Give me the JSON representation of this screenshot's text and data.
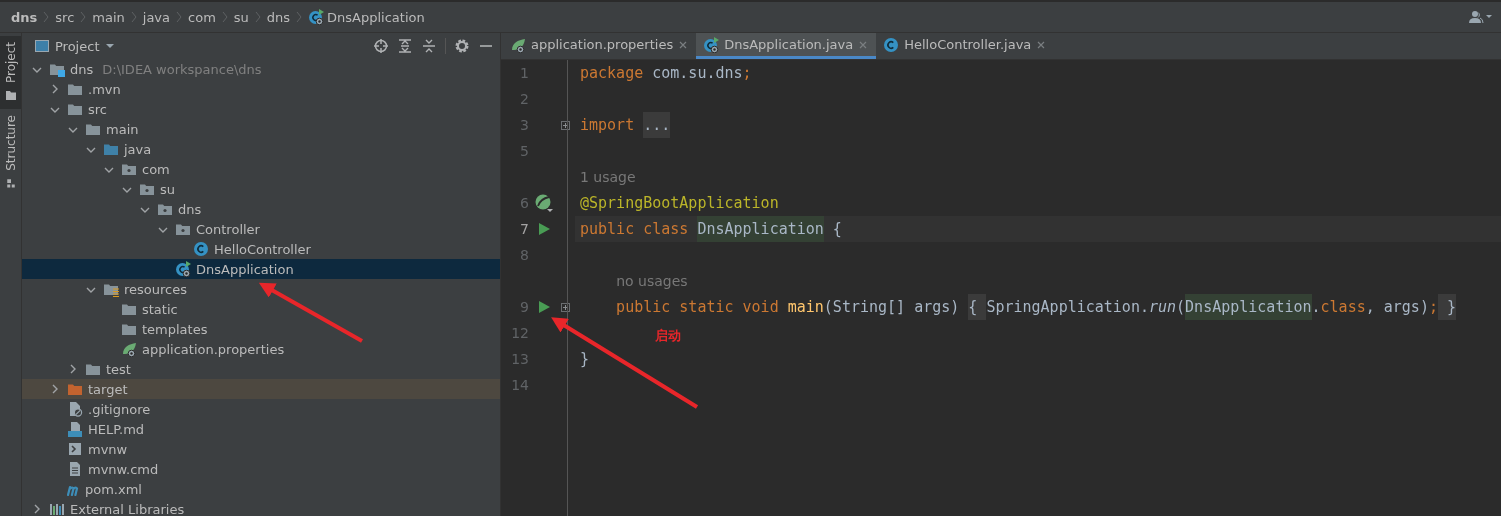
{
  "breadcrumbs": [
    {
      "label": "dns",
      "kind": "project"
    },
    {
      "label": "src",
      "kind": "folder"
    },
    {
      "label": "main",
      "kind": "folder"
    },
    {
      "label": "java",
      "kind": "folder"
    },
    {
      "label": "com",
      "kind": "folder"
    },
    {
      "label": "su",
      "kind": "folder"
    },
    {
      "label": "dns",
      "kind": "folder"
    },
    {
      "label": "DnsApplication",
      "kind": "spring-class"
    }
  ],
  "tool_strip": [
    {
      "label": "Project",
      "selected": true
    },
    {
      "label": "Structure",
      "selected": false
    }
  ],
  "project_panel": {
    "title": "Project",
    "tree": [
      {
        "label": "dns",
        "kind": "module",
        "hint": "D:\\IDEA workspance\\dns",
        "expanded": true,
        "selected": false,
        "children": [
          {
            "label": ".mvn",
            "kind": "folder",
            "expanded": false,
            "selected": false
          },
          {
            "label": "src",
            "kind": "folder",
            "expanded": true,
            "selected": false,
            "children": [
              {
                "label": "main",
                "kind": "folder",
                "expanded": true,
                "selected": false,
                "children": [
                  {
                    "label": "java",
                    "kind": "source",
                    "expanded": true,
                    "selected": false,
                    "children": [
                      {
                        "label": "com",
                        "kind": "package",
                        "expanded": true,
                        "selected": false,
                        "children": [
                          {
                            "label": "su",
                            "kind": "package",
                            "expanded": true,
                            "selected": false,
                            "children": [
                              {
                                "label": "dns",
                                "kind": "package",
                                "expanded": true,
                                "selected": false,
                                "children": [
                                  {
                                    "label": "Controller",
                                    "kind": "package",
                                    "expanded": true,
                                    "selected": false,
                                    "children": [
                                      {
                                        "label": "HelloController",
                                        "kind": "class",
                                        "selected": false
                                      }
                                    ]
                                  },
                                  {
                                    "label": "DnsApplication",
                                    "kind": "spring-class",
                                    "selected": true
                                  }
                                ]
                              }
                            ]
                          }
                        ]
                      }
                    ]
                  },
                  {
                    "label": "resources",
                    "kind": "resources",
                    "expanded": true,
                    "selected": false,
                    "children": [
                      {
                        "label": "static",
                        "kind": "folder",
                        "selected": false
                      },
                      {
                        "label": "templates",
                        "kind": "folder",
                        "selected": false
                      },
                      {
                        "label": "application.properties",
                        "kind": "spring-file",
                        "selected": false
                      }
                    ]
                  }
                ]
              },
              {
                "label": "test",
                "kind": "folder",
                "expanded": false,
                "selected": false
              }
            ]
          },
          {
            "label": "target",
            "kind": "excluded",
            "expanded": false,
            "selected": false
          },
          {
            "label": ".gitignore",
            "kind": "ignore-file",
            "selected": false
          },
          {
            "label": "HELP.md",
            "kind": "md-file",
            "selected": false
          },
          {
            "label": "mvnw",
            "kind": "shell-file",
            "selected": false
          },
          {
            "label": "mvnw.cmd",
            "kind": "text-file",
            "selected": false
          },
          {
            "label": "pom.xml",
            "kind": "maven",
            "selected": false
          }
        ]
      },
      {
        "label": "External Libraries",
        "kind": "library",
        "expanded": false,
        "selected": false
      }
    ]
  },
  "editor": {
    "tabs": [
      {
        "label": "application.properties",
        "kind": "spring-file",
        "selected": false
      },
      {
        "label": "DnsApplication.java",
        "kind": "spring-class",
        "selected": true
      },
      {
        "label": "HelloController.java",
        "kind": "class",
        "selected": false
      }
    ],
    "lines": [
      {
        "kind": "code",
        "number": "1",
        "current": false,
        "foldable": false,
        "tokens": [
          {
            "text": "package",
            "kind": "keyword"
          },
          {
            "text": " com.su.dns",
            "kind": "plain"
          },
          {
            "text": ";",
            "kind": "keyword"
          }
        ]
      },
      {
        "kind": "code",
        "number": "2",
        "current": false,
        "foldable": false
      },
      {
        "kind": "code",
        "number": "3",
        "current": false,
        "foldable": true,
        "tokens": [
          {
            "text": "import ",
            "kind": "keyword"
          },
          {
            "text": "...",
            "kind": "folded"
          }
        ]
      },
      {
        "kind": "code",
        "number": "5",
        "current": false,
        "foldable": false
      },
      {
        "kind": "hint",
        "text": "1 usage"
      },
      {
        "kind": "bean",
        "number": "6",
        "current": false,
        "foldable": false,
        "tokens": [
          {
            "text": "@SpringBootApplication",
            "kind": "annotation"
          }
        ]
      },
      {
        "kind": "runnable",
        "number": "7",
        "current": true,
        "foldable": false,
        "tokens": [
          {
            "text": "public class ",
            "kind": "keyword"
          },
          {
            "text": "DnsApplication",
            "kind": "usage"
          },
          {
            "text": " {",
            "kind": "plain"
          }
        ]
      },
      {
        "kind": "code",
        "number": "8",
        "current": false,
        "foldable": false
      },
      {
        "kind": "hint",
        "text": "    no usages"
      },
      {
        "kind": "runnable",
        "number": "9",
        "current": false,
        "foldable": true,
        "tokens": [
          {
            "text": "    public static void ",
            "kind": "keyword"
          },
          {
            "text": "main",
            "kind": "method"
          },
          {
            "text": "(String[] args) ",
            "kind": "plain"
          },
          {
            "text": "{ ",
            "kind": "folded"
          },
          {
            "text": "SpringApplication.",
            "kind": "plain"
          },
          {
            "text": "run",
            "kind": "static-call"
          },
          {
            "text": "(",
            "kind": "plain"
          },
          {
            "text": "DnsApplication",
            "kind": "usage"
          },
          {
            "text": ".",
            "kind": "plain"
          },
          {
            "text": "class",
            "kind": "keyword"
          },
          {
            "text": ", args)",
            "kind": "plain"
          },
          {
            "text": ";",
            "kind": "keyword"
          },
          {
            "text": " }",
            "kind": "folded"
          }
        ]
      },
      {
        "kind": "code",
        "number": "12",
        "current": false,
        "foldable": false
      },
      {
        "kind": "code",
        "number": "13",
        "current": false,
        "foldable": false,
        "tokens": [
          {
            "text": "}",
            "kind": "plain"
          }
        ]
      },
      {
        "kind": "code",
        "number": "14",
        "current": false,
        "foldable": false
      }
    ]
  },
  "annotation": {
    "label": "启动"
  }
}
